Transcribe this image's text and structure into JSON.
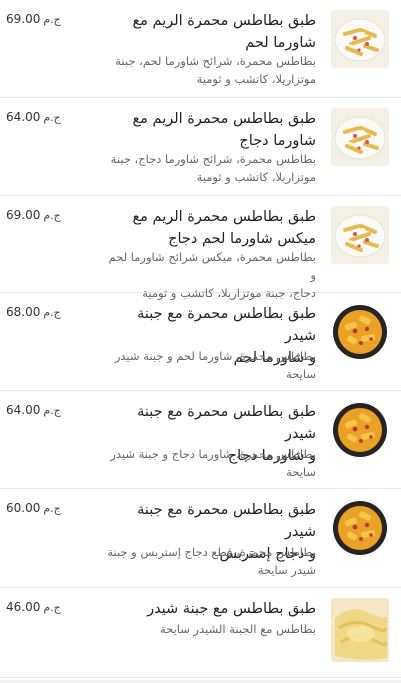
{
  "currency": "ج.م",
  "items": [
    {
      "title_line1": "طبق بطاطس محمرة الريم مع",
      "title_line2": "شاورما لحم",
      "desc_line1": "بطاطس محمرة، شرائح شاورما لحم، جبنة",
      "desc_line2": "موتزاريلا، كاتشب و ثومية",
      "price": "69.00",
      "image": "fries-plate"
    },
    {
      "title_line1": "طبق بطاطس محمرة الريم مع",
      "title_line2": "شاورما دجاج",
      "desc_line1": "بطاطس محمرة، شرائح شاورما دجاج، جبنة",
      "desc_line2": "موتزاريلا، كاتشب و ثومية",
      "price": "64.00",
      "image": "fries-plate"
    },
    {
      "title_line1": "طبق بطاطس محمرة الريم مع",
      "title_line2": "ميكس شاورما لحم دجاج",
      "desc_line1": "بطاطس محمرة، ميكس شرائح شاورما لحم و",
      "desc_line2": "دجاج، جبنة موتزاريلا، كاتشب و ثومية",
      "price": "69.00",
      "image": "fries-plate"
    },
    {
      "title_line1": "طبق بطاطس محمرة مع جبنة شيدر",
      "title_line2": "و شاورما لحم",
      "desc_line1": "بطاطس محمرة، شاورما لحم و جبنة شيدر",
      "desc_line2": "سايحة",
      "price": "68.00",
      "image": "cheddar-bowl"
    },
    {
      "title_line1": "طبق بطاطس محمرة مع جبنة شيدر",
      "title_line2": "و شاورما دجاج",
      "desc_line1": "بطاطس محمرة، شاورما دجاج و جبنة شيدر",
      "desc_line2": "سايحة",
      "price": "64.00",
      "image": "cheddar-bowl"
    },
    {
      "title_line1": "طبق بطاطس محمرة مع جبنة شيدر",
      "title_line2": "و دجاج إستربس",
      "desc_line1": "بطاطس محمرة، قطع دجاج إستربس و جبنة",
      "desc_line2": "شيدر سايحة",
      "price": "60.00",
      "image": "cheddar-bowl"
    },
    {
      "title_line1": "طبق بطاطس مع جبنة شيدر",
      "title_line2": "",
      "desc_line1": "بطاطس مع الجبنة الشيدر سايحة",
      "desc_line2": "",
      "price": "46.00",
      "image": "cheese-fries"
    }
  ]
}
